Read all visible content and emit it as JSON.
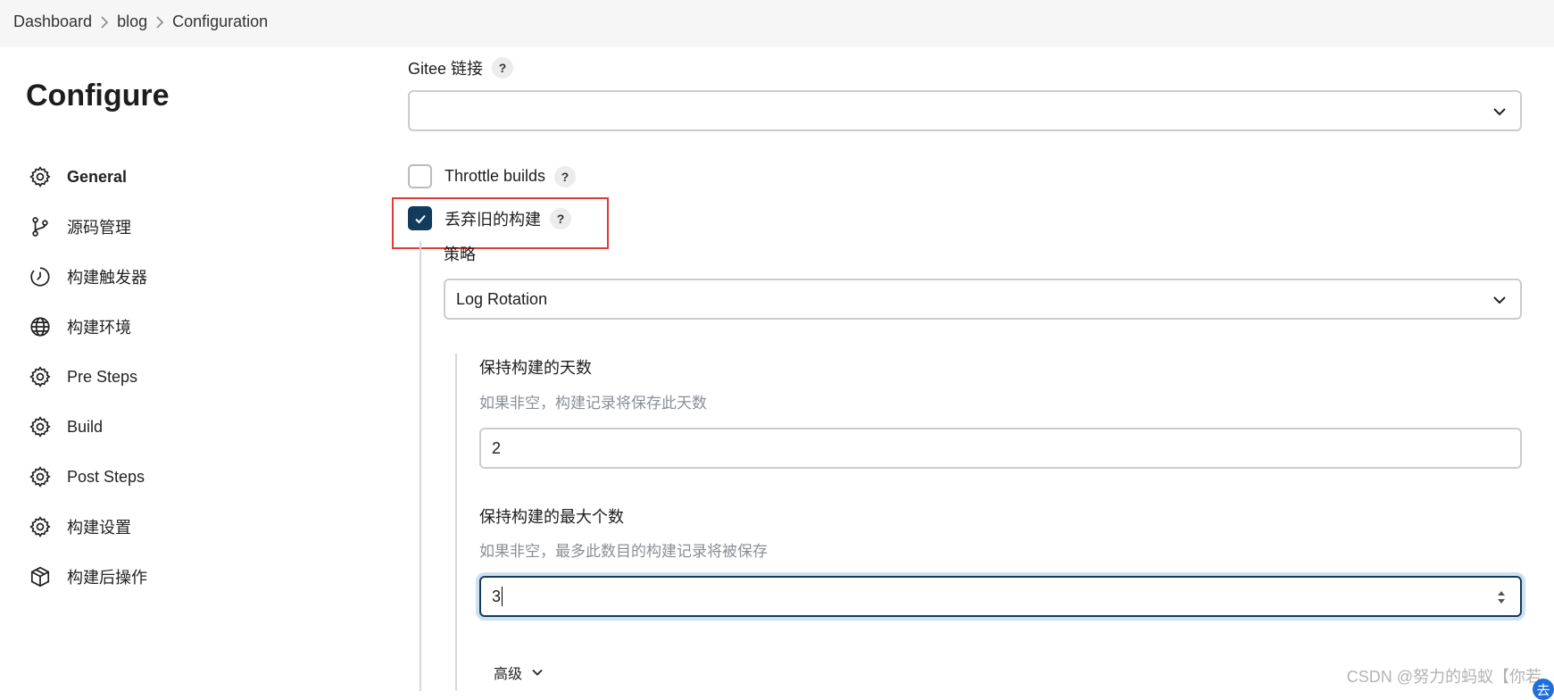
{
  "breadcrumb": {
    "items": [
      "Dashboard",
      "blog",
      "Configuration"
    ]
  },
  "sidebar": {
    "title": "Configure",
    "items": [
      {
        "label": "General",
        "icon": "gear-icon",
        "active": true
      },
      {
        "label": "源码管理",
        "icon": "source-branch-icon"
      },
      {
        "label": "构建触发器",
        "icon": "clock-icon"
      },
      {
        "label": "构建环境",
        "icon": "globe-icon"
      },
      {
        "label": "Pre Steps",
        "icon": "gear-icon"
      },
      {
        "label": "Build",
        "icon": "gear-icon"
      },
      {
        "label": "Post Steps",
        "icon": "gear-icon"
      },
      {
        "label": "构建设置",
        "icon": "gear-icon"
      },
      {
        "label": "构建后操作",
        "icon": "package-icon"
      }
    ]
  },
  "main": {
    "gitee": {
      "label": "Gitee 链接",
      "help": "?",
      "value": ""
    },
    "throttle": {
      "label": "Throttle builds",
      "help": "?",
      "checked": false
    },
    "discard": {
      "label": "丢弃旧的构建",
      "help": "?",
      "checked": true
    },
    "strategy": {
      "label": "策略",
      "value": "Log Rotation"
    },
    "days": {
      "label": "保持构建的天数",
      "description": "如果非空，构建记录将保存此天数",
      "value": "2"
    },
    "max_builds": {
      "label": "保持构建的最大个数",
      "description": "如果非空，最多此数目的构建记录将被保存",
      "value": "3"
    },
    "advanced": {
      "label": "高级"
    }
  },
  "watermark": {
    "text": "CSDN @努力的蚂蚁【你若",
    "badge": "去"
  },
  "colors": {
    "accent": "#113c5e",
    "highlight": "#e53935",
    "border": "#c9ccd1",
    "description": "#8a8f96",
    "topbar": "#f6f6f7"
  }
}
